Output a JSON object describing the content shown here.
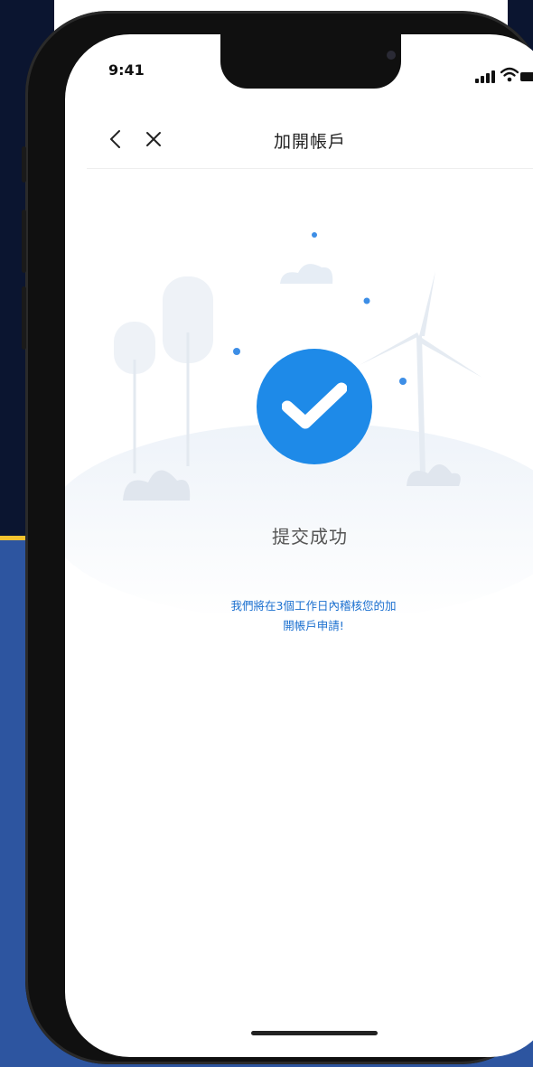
{
  "status_bar": {
    "time": "9:41",
    "icons": [
      "signal-icon",
      "wifi-icon",
      "battery-icon"
    ]
  },
  "nav": {
    "back_icon": "chevron-left-icon",
    "close_icon": "close-icon",
    "title": "加開帳戶"
  },
  "result": {
    "icon": "checkmark-icon",
    "title": "提交成功",
    "message_line1": "我們將在3個工作日內稽核您的加",
    "message_line2": "開帳戶申請!"
  },
  "colors": {
    "accent": "#1e8ae8",
    "link_text": "#1a6fcf",
    "background_blue": "#2d55a0",
    "background_yellow": "#f2c230"
  }
}
